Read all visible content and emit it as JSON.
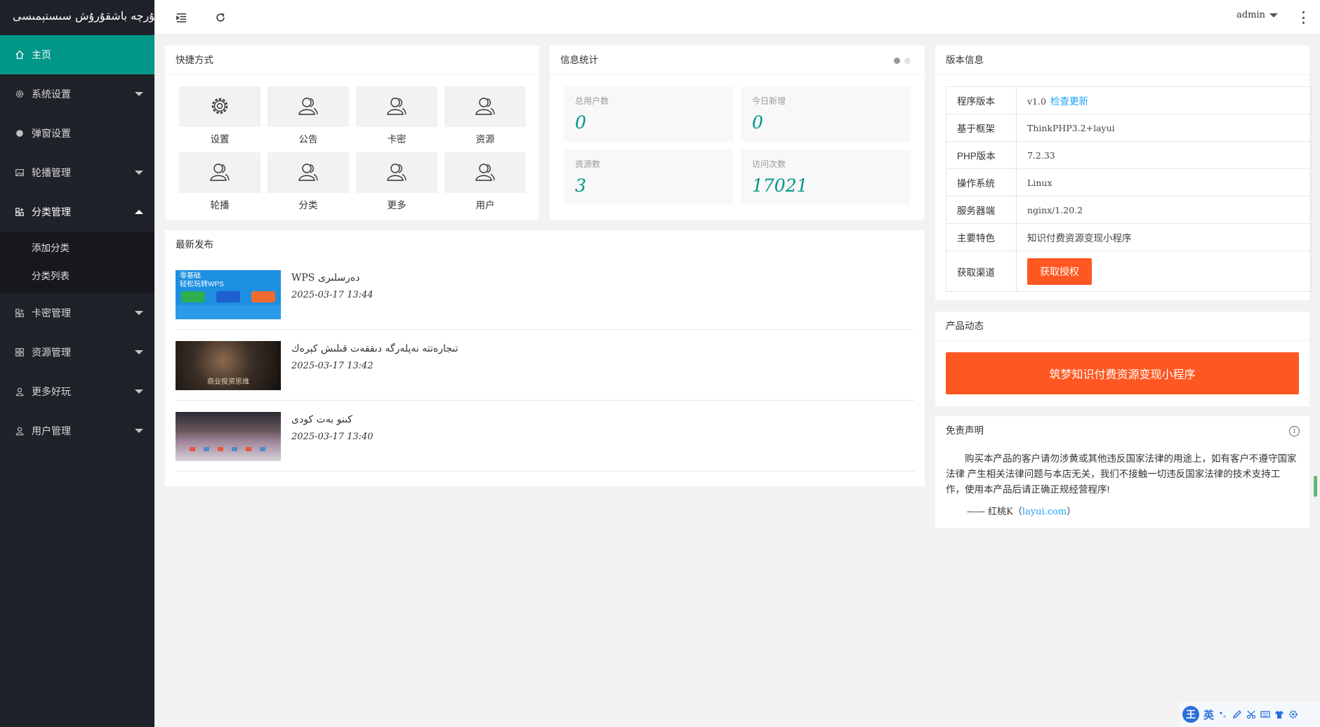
{
  "app": {
    "logo_text": "ئۇيغۇرچە باشقۇرۇش سىستېمىسى总后台"
  },
  "sidebar": {
    "items": [
      {
        "label": "主页",
        "icon": "home-icon"
      },
      {
        "label": "系统设置",
        "icon": "gear-icon"
      },
      {
        "label": "弹窗设置",
        "icon": "circle-icon"
      },
      {
        "label": "轮播管理",
        "icon": "image-icon"
      },
      {
        "label": "分类管理",
        "icon": "app-icon"
      },
      {
        "label": "卡密管理",
        "icon": "app-icon"
      },
      {
        "label": "资源管理",
        "icon": "app-icon"
      },
      {
        "label": "更多好玩",
        "icon": "user-icon"
      },
      {
        "label": "用户管理",
        "icon": "user-icon"
      }
    ],
    "sub_items": [
      "添加分类",
      "分类列表"
    ]
  },
  "header": {
    "user": "admin"
  },
  "shortcuts": {
    "title": "快捷方式",
    "items": [
      {
        "label": "设置",
        "icon": "gear-icon"
      },
      {
        "label": "公告",
        "icon": "user-icon"
      },
      {
        "label": "卡密",
        "icon": "user-icon"
      },
      {
        "label": "资源",
        "icon": "user-icon"
      },
      {
        "label": "轮播",
        "icon": "user-icon"
      },
      {
        "label": "分类",
        "icon": "user-icon"
      },
      {
        "label": "更多",
        "icon": "user-icon"
      },
      {
        "label": "用户",
        "icon": "user-icon"
      }
    ]
  },
  "stats": {
    "title": "信息统计",
    "items": [
      {
        "label": "总用户数",
        "value": "0"
      },
      {
        "label": "今日新增",
        "value": "0"
      },
      {
        "label": "资源数",
        "value": "3"
      },
      {
        "label": "访问次数",
        "value": "17021"
      }
    ]
  },
  "news": {
    "title": "最新发布",
    "items": [
      {
        "title": "WPS دەرسلىرى",
        "date": "2025-03-17 13:44"
      },
      {
        "title": "تىجارەتتە نەپلەرگە دىققەت قىلىش كېرەك",
        "date": "2025-03-17 13:42"
      },
      {
        "title": "كىنو بەت كودى",
        "date": "2025-03-17 13:40"
      }
    ],
    "thumb1": {
      "line1": "零基础",
      "line2": "轻松玩转WPS"
    },
    "thumb2": {
      "caption": "商业投资思维"
    }
  },
  "version": {
    "title": "版本信息",
    "rows": [
      {
        "key": "程序版本",
        "value": "v1.0"
      },
      {
        "key": "基于框架",
        "value": "ThinkPHP3.2+layui"
      },
      {
        "key": "PHP版本",
        "value": "7.2.33"
      },
      {
        "key": "操作系统",
        "value": "Linux"
      },
      {
        "key": "服务器端",
        "value": "nginx/1.20.2"
      },
      {
        "key": "主要特色",
        "value": "知识付费资源变现小程序"
      },
      {
        "key": "获取渠道",
        "value": ""
      }
    ],
    "check_update": "检查更新",
    "get_license": "获取授权"
  },
  "product": {
    "title": "产品动态",
    "banner": "筑梦知识付费资源变现小程序"
  },
  "disclaimer": {
    "title": "免责声明",
    "text": "购买本产品的客户请勿涉黄或其他违反国家法律的用途上，如有客户不遵守国家法律 产生相关法律问题与本店无关，我们不接触一切违反国家法律的技术支持工作，使用本产品后请正确正规经营程序!",
    "sig_prefix": "—— 红桃K（",
    "sig_link": "layui.com",
    "sig_suffix": "）"
  },
  "ime": {
    "logo": "王",
    "mode": "英"
  },
  "colors": {
    "sidebar_bg": "#20222a",
    "accent": "#009688",
    "orange": "#ff5722",
    "link": "#1e9fff"
  }
}
